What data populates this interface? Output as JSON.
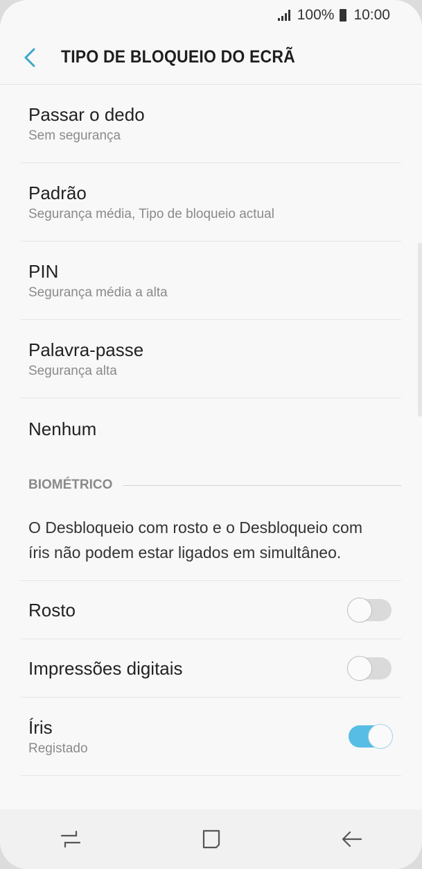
{
  "status": {
    "battery": "100%",
    "time": "10:00"
  },
  "header": {
    "title": "TIPO DE BLOQUEIO DO ECRÃ"
  },
  "options": [
    {
      "title": "Passar o dedo",
      "subtitle": "Sem segurança"
    },
    {
      "title": "Padrão",
      "subtitle": "Segurança média, Tipo de bloqueio actual"
    },
    {
      "title": "PIN",
      "subtitle": "Segurança média a alta"
    },
    {
      "title": "Palavra-passe",
      "subtitle": "Segurança alta"
    },
    {
      "title": "Nenhum"
    }
  ],
  "biometric": {
    "section_label": "BIOMÉTRICO",
    "description": "O Desbloqueio com rosto e o Desbloqueio com íris não podem estar ligados em simultâneo.",
    "toggles": [
      {
        "title": "Rosto",
        "on": false
      },
      {
        "title": "Impressões digitais",
        "on": false
      },
      {
        "title": "Íris",
        "subtitle": "Registado",
        "on": true
      }
    ]
  },
  "colors": {
    "accent": "#57bde4",
    "back_arrow": "#3aa6c8"
  },
  "navbar": {
    "icons": [
      "recent-apps-icon",
      "home-icon",
      "back-icon"
    ]
  }
}
